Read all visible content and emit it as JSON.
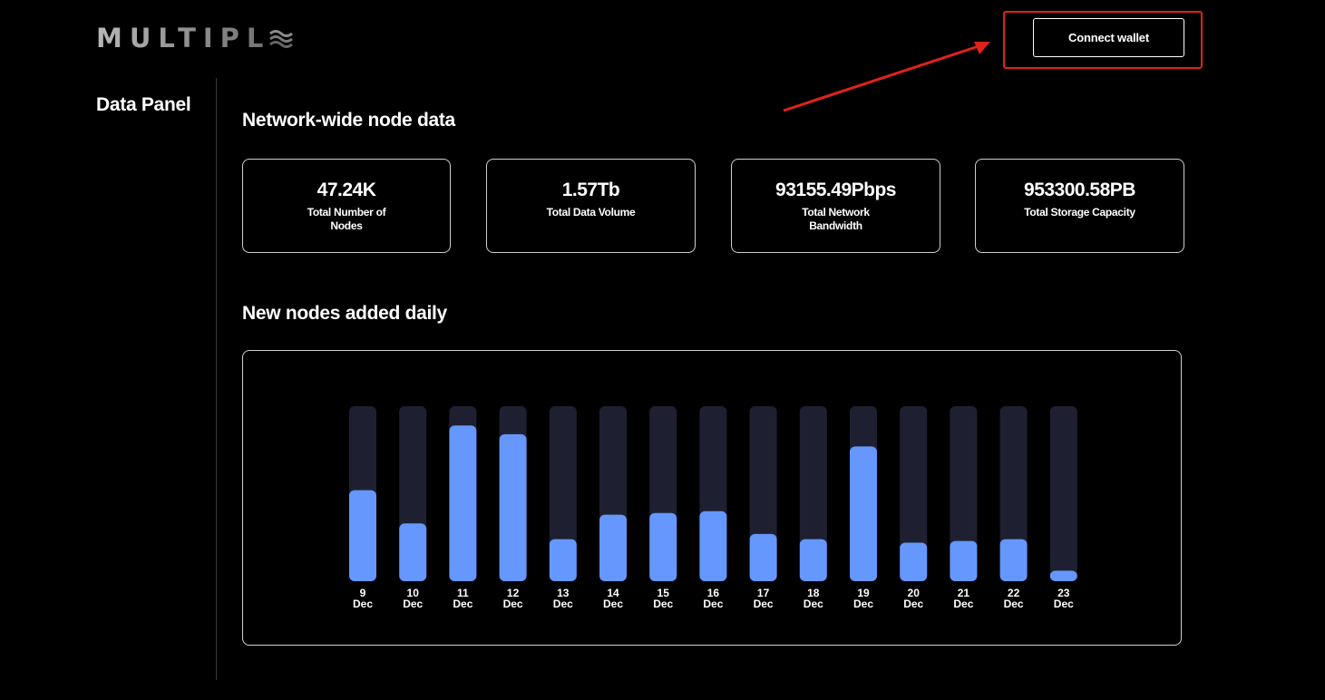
{
  "header": {
    "logo_text": "MULTIPL",
    "connect_label": "Connect wallet"
  },
  "sidebar": {
    "title": "Data Panel"
  },
  "main": {
    "network_title": "Network-wide node data",
    "stats": [
      {
        "value": "47.24K",
        "label": "Total Number of Nodes"
      },
      {
        "value": "1.57Tb",
        "label": "Total Data Volume"
      },
      {
        "value": "93155.49Pbps",
        "label": "Total Network Bandwidth"
      },
      {
        "value": "953300.58PB",
        "label": "Total Storage Capacity"
      }
    ],
    "chart_title": "New nodes added daily"
  },
  "colors": {
    "background": "#000000",
    "bar_fill": "#6597fd",
    "bar_track": "#1e2031",
    "annotation": "#e0221c"
  },
  "chart_data": {
    "type": "bar",
    "title": "New nodes added daily",
    "categories": [
      "9 Dec",
      "10 Dec",
      "11 Dec",
      "12 Dec",
      "13 Dec",
      "14 Dec",
      "15 Dec",
      "16 Dec",
      "17 Dec",
      "18 Dec",
      "19 Dec",
      "20 Dec",
      "21 Dec",
      "22 Dec",
      "23 Dec"
    ],
    "values": [
      0.52,
      0.33,
      0.89,
      0.84,
      0.24,
      0.38,
      0.39,
      0.4,
      0.27,
      0.24,
      0.77,
      0.22,
      0.23,
      0.24,
      0.06
    ],
    "ylim": [
      0,
      1
    ],
    "grid": false,
    "legend": "none"
  }
}
